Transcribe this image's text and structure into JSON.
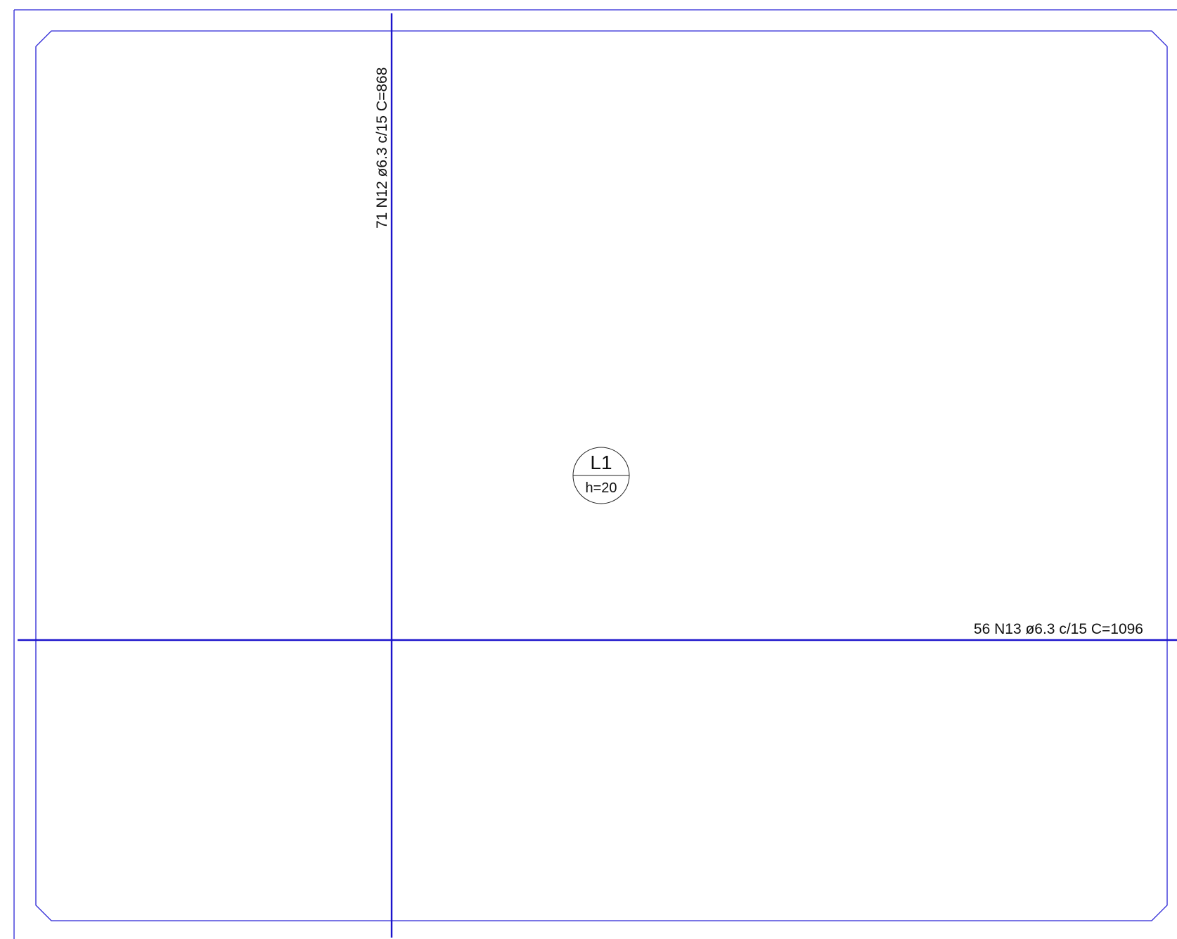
{
  "slab": {
    "name": "L1",
    "thickness": "h=20"
  },
  "rebars": {
    "vertical": {
      "label": "71 N12 ø6.3 c/15 C=868"
    },
    "horizontal": {
      "label": "56 N13 ø6.3 c/15 C=1096"
    }
  },
  "colors": {
    "outline": "#2a24d6",
    "rebar": "#1c14cc",
    "text": "#111111"
  }
}
